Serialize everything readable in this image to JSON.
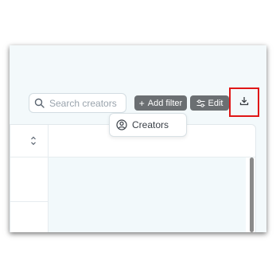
{
  "toolbar": {
    "search": {
      "placeholder": "Search creators",
      "value": "",
      "icon": "search-icon"
    },
    "add_filter_label": "Add filter",
    "add_filter_icon": "plus-icon",
    "edit_label": "Edit",
    "edit_icon": "sliders-icon",
    "download_icon": "download-icon",
    "download_highlight_color": "#e01616"
  },
  "dropdown": {
    "items": [
      {
        "label": "Creators",
        "icon": "user-circle-icon"
      }
    ]
  },
  "table": {
    "sort_icon": "sort-icon"
  },
  "colors": {
    "background": "#f3f9fb",
    "button": "#6b6f72"
  }
}
